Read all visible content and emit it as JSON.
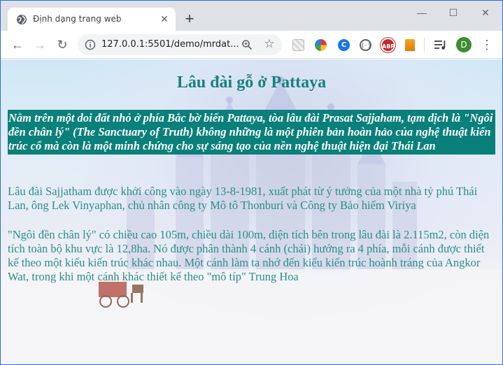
{
  "browser": {
    "tab_title": "Định dạng trang web",
    "url": "127.0.0.1:5501/demo/mrdat...",
    "avatar_letter": "D",
    "extension_3_label": "C",
    "extension_4_label": "{-}",
    "extension_5_label": "ABP",
    "tab_close": "✕",
    "new_tab": "+",
    "window_min": "—",
    "window_max": "☐",
    "window_close": "✕",
    "back": "←",
    "forward": "→",
    "reload": "↻",
    "star": "☆",
    "menu": "⋮"
  },
  "page": {
    "heading": "Lâu đài gỗ ở Pattaya",
    "intro": "Nằm trên một doi đất nhỏ ở phía Bắc bờ biển Pattaya, tòa lâu đài Prasat Sajjaham, tạm dịch là \"Ngôi đền chân lý\" (The Sanctuary of Truth) không những là một phiên bản hoàn hảo của nghệ thuật kiến trúc cổ mà còn là một minh chứng cho sự sáng tạo của nền nghệ thuật hiện đại Thái Lan",
    "paragraph1": "Lâu đài Sajjatham được khởi công vào ngày 13-8-1981, xuất phát từ ý tưởng của một nhà tỷ phú Thái Lan, ông Lek Vinyaphan, chủ nhân công ty Mô tô Thonburi và Công ty Bảo hiểm Viriya",
    "paragraph2": "\"Ngôi đền chân lý\" có chiều cao 105m, chiều dài 100m, diện tích bên trong lâu đài là 2.115m2, còn diện tích toàn bộ khu vực là 12,8ha. Nó được phân thành 4 cánh (chái) hướng ra 4 phía, mỗi cánh được thiết kế theo một kiểu kiến trúc khác nhau. Một cánh làm ta nhớ đến kiểu kiến trúc hoành tráng của Angkor Wat, trong khi một cánh khác thiết kế theo \"mô típ\" Trung Hoa"
  },
  "colors": {
    "heading": "#17827f",
    "intro_bg": "#0a807b",
    "paragraph_text": "#2a8e8a",
    "window_border": "#2a6fd6"
  },
  "icons": [
    "globe-icon",
    "close-icon",
    "plus-icon",
    "minimize-icon",
    "maximize-icon",
    "back-arrow-icon",
    "forward-arrow-icon",
    "reload-icon",
    "info-icon",
    "zoom-icon",
    "star-icon",
    "playlist-icon",
    "kebab-menu-icon"
  ]
}
